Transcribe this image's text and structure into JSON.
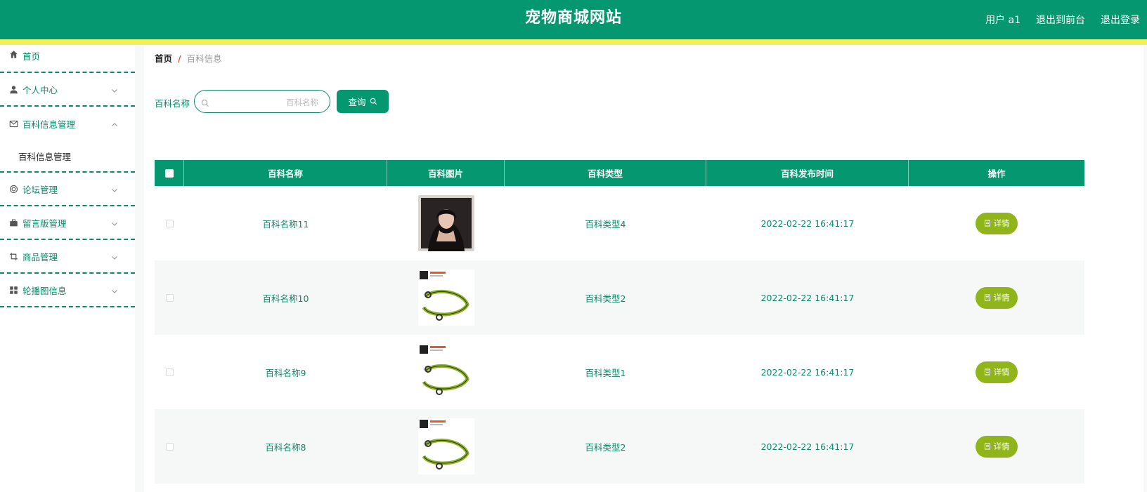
{
  "header": {
    "title": "宠物商城网站",
    "user": "用户 a1",
    "to_front": "退出到前台",
    "logout": "退出登录",
    "colors": {
      "bar": "#05976f",
      "stripe": "#f2ef5c"
    }
  },
  "sidebar": {
    "home": {
      "label": "首页",
      "icon": "home-icon"
    },
    "items": [
      {
        "label": "个人中心",
        "icon": "user-icon"
      },
      {
        "label": "百科信息管理",
        "icon": "mail-icon",
        "expanded": true,
        "sub": "百科信息管理"
      },
      {
        "label": "论坛管理",
        "icon": "circle-icon"
      },
      {
        "label": "留言版管理",
        "icon": "briefcase-icon"
      },
      {
        "label": "商品管理",
        "icon": "crop-icon"
      },
      {
        "label": "轮播图信息",
        "icon": "grid-icon"
      }
    ]
  },
  "breadcrumb": {
    "home": "首页",
    "sep": "/",
    "current": "百科信息"
  },
  "search": {
    "label": "百科名称",
    "placeholder": "百科名称",
    "value": "",
    "button": "查询"
  },
  "table": {
    "headers": [
      "百科名称",
      "百科图片",
      "百科类型",
      "百科发布时间",
      "操作"
    ],
    "rows": [
      {
        "name": "百科名称11",
        "image": "portrait-photo",
        "type": "百科类型4",
        "time": "2022-02-22 16:41:17",
        "action": "详情"
      },
      {
        "name": "百科名称10",
        "image": "leash-photo",
        "type": "百科类型2",
        "time": "2022-02-22 16:41:17",
        "action": "详情"
      },
      {
        "name": "百科名称9",
        "image": "leash-photo",
        "type": "百科类型1",
        "time": "2022-02-22 16:41:17",
        "action": "详情"
      },
      {
        "name": "百科名称8",
        "image": "leash-photo",
        "type": "百科类型2",
        "time": "2022-02-22 16:41:17",
        "action": "详情"
      }
    ]
  }
}
